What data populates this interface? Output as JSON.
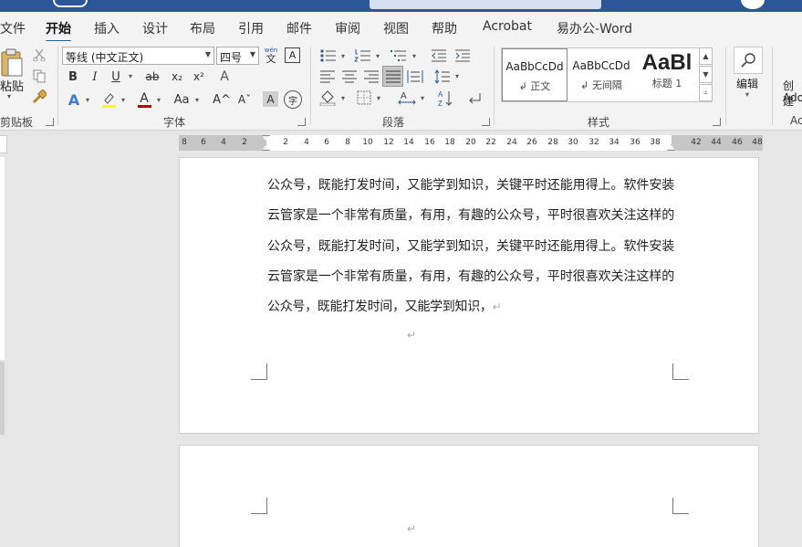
{
  "tabs": [
    {
      "label": "文件"
    },
    {
      "label": "开始"
    },
    {
      "label": "插入"
    },
    {
      "label": "设计"
    },
    {
      "label": "布局"
    },
    {
      "label": "引用"
    },
    {
      "label": "邮件"
    },
    {
      "label": "审阅"
    },
    {
      "label": "视图"
    },
    {
      "label": "帮助"
    },
    {
      "label": "Acrobat"
    },
    {
      "label": "易办公-Word"
    }
  ],
  "ribbon": {
    "clipboard": {
      "paste_label": "粘贴",
      "group_label": "剪贴板"
    },
    "font": {
      "font_name": "等线 (中文正文)",
      "font_size": "四号",
      "wen_label": "wén",
      "wen_char": "文",
      "border_char": "A",
      "bold": "B",
      "italic": "I",
      "underline": "U",
      "strike": "ab",
      "subscript": "x₂",
      "superscript": "x²",
      "clear_format": "A",
      "text_effect": "A",
      "highlight": "ab",
      "font_color": "A",
      "change_case": "Aa",
      "grow": "A^",
      "shrink": "Aˇ",
      "char_shading": "A",
      "enclose": "字",
      "group_label": "字体"
    },
    "paragraph": {
      "group_label": "段落"
    },
    "styles": {
      "items": [
        {
          "sample": "AaBbCcDd",
          "name": "↲ 正文"
        },
        {
          "sample": "AaBbCcDd",
          "name": "↲ 无间隔"
        },
        {
          "sample": "AaBl",
          "name": "标题 1"
        }
      ],
      "group_label": "样式"
    },
    "editing": {
      "label": "编辑"
    },
    "create": {
      "label1": "创建",
      "label2": "Ado"
    },
    "acrobat_group_label": "Ac"
  },
  "ruler": {
    "left_numbers": [
      "8",
      "6",
      "4",
      "2"
    ],
    "numbers": [
      "2",
      "4",
      "6",
      "8",
      "10",
      "12",
      "14",
      "16",
      "18",
      "20",
      "22",
      "24",
      "26",
      "28",
      "30",
      "32",
      "34",
      "36",
      "38"
    ],
    "right_numbers": [
      "42",
      "44",
      "46",
      "48"
    ]
  },
  "document": {
    "page1_text": "公众号，既能打发时间，又能学到知识，关键平时还能用得上。软件安装云管家是一个非常有质量，有用，有趣的公众号，平时很喜欢关注这样的公众号，既能打发时间，又能学到知识，关键平时还能用得上。软件安装云管家是一个非常有质量，有用，有趣的公众号，平时很喜欢关注这样的公众号，既能打发时间，又能学到知识，",
    "para_mark": "↵"
  },
  "colors": {
    "accent": "#2b579a",
    "highlight_yellow": "#ffff00",
    "font_red": "#c00000"
  }
}
